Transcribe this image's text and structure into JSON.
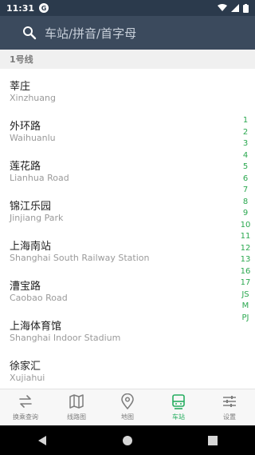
{
  "status": {
    "time": "11:31",
    "badge": "G"
  },
  "search": {
    "placeholder": "车站/拼音/首字母"
  },
  "section": {
    "title": "1号线"
  },
  "stations": [
    {
      "cn": "莘庄",
      "en": "Xinzhuang"
    },
    {
      "cn": "外环路",
      "en": "Waihuanlu"
    },
    {
      "cn": "莲花路",
      "en": "Lianhua Road"
    },
    {
      "cn": "锦江乐园",
      "en": "Jinjiang Park"
    },
    {
      "cn": "上海南站",
      "en": "Shanghai South Railway Station"
    },
    {
      "cn": "漕宝路",
      "en": "Caobao Road"
    },
    {
      "cn": "上海体育馆",
      "en": "Shanghai Indoor Stadium"
    },
    {
      "cn": "徐家汇",
      "en": "Xujiahui"
    }
  ],
  "index": [
    "1",
    "2",
    "3",
    "4",
    "5",
    "6",
    "7",
    "8",
    "9",
    "10",
    "11",
    "12",
    "13",
    "16",
    "17",
    "JS",
    "M",
    "PJ"
  ],
  "tabs": [
    {
      "label": "换乘查询",
      "icon": "transfer-icon",
      "active": false
    },
    {
      "label": "线路图",
      "icon": "map-book-icon",
      "active": false
    },
    {
      "label": "地图",
      "icon": "location-pin-icon",
      "active": false
    },
    {
      "label": "车站",
      "icon": "train-icon",
      "active": true
    },
    {
      "label": "设置",
      "icon": "sliders-icon",
      "active": false
    }
  ],
  "colors": {
    "header": "#3b4a5d",
    "statusbar": "#2b3a4c",
    "accent": "#27ae60",
    "inactive": "#7d7d7d"
  }
}
